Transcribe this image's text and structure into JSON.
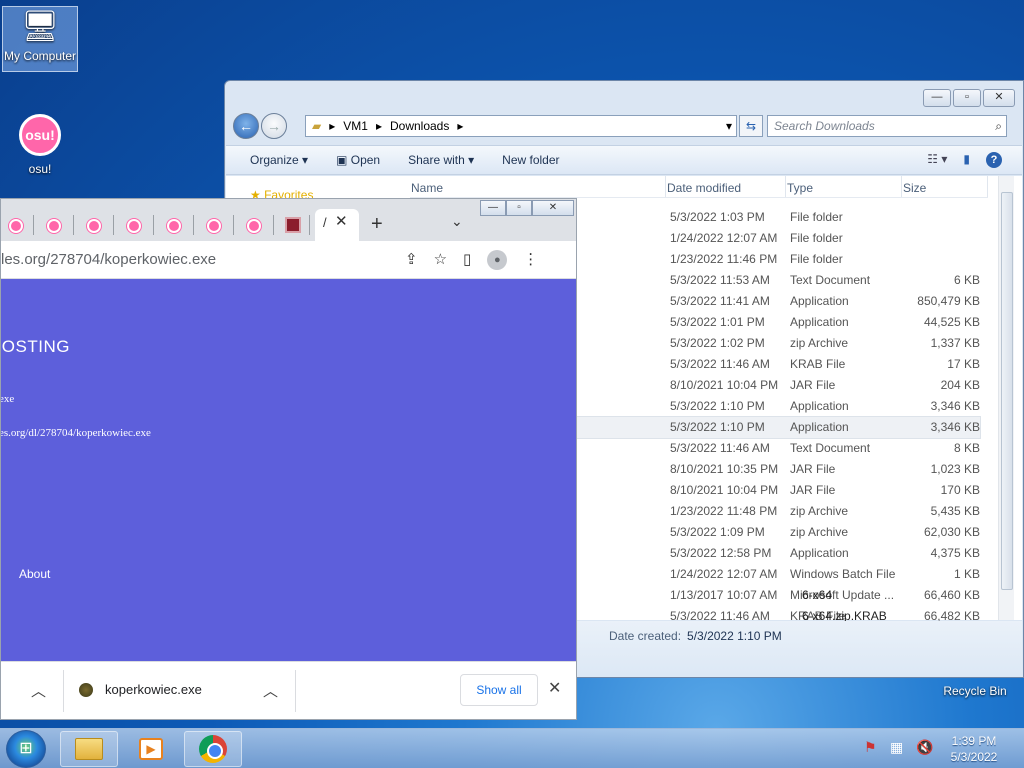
{
  "desktop": {
    "icons": [
      {
        "label": "My Computer",
        "glyph": "🖥"
      },
      {
        "label": "osu!",
        "badge": "osu!"
      },
      {
        "label": "Recycle Bin"
      }
    ]
  },
  "explorer": {
    "window_controls": [
      "—",
      "▫",
      "✕"
    ],
    "address": {
      "part1": "VM1",
      "part2": "Downloads"
    },
    "search_placeholder": "Search Downloads",
    "toolbar": {
      "organize": "Organize ▾",
      "open": "Open",
      "share_with": "Share with ▾",
      "new_folder": "New folder"
    },
    "nav_pane_favorites": "Favorites",
    "columns": {
      "name": "Name",
      "date": "Date modified",
      "type": "Type",
      "size": "Size"
    },
    "rows": [
      {
        "date": "5/3/2022 1:03 PM",
        "type": "File folder",
        "size": ""
      },
      {
        "date": "1/24/2022 12:07 AM",
        "type": "File folder",
        "size": ""
      },
      {
        "date": "1/23/2022 11:46 PM",
        "type": "File folder",
        "size": ""
      },
      {
        "date": "5/3/2022 11:53 AM",
        "type": "Text Document",
        "size": "6 KB"
      },
      {
        "date": "5/3/2022 11:41 AM",
        "type": "Application",
        "size": "850,479 KB"
      },
      {
        "date": "5/3/2022 1:01 PM",
        "type": "Application",
        "size": "44,525 KB"
      },
      {
        "date": "5/3/2022 1:02 PM",
        "type": "zip Archive",
        "size": "1,337 KB"
      },
      {
        "date": "5/3/2022 11:46 AM",
        "type": "KRAB File",
        "size": "17 KB"
      },
      {
        "date": "8/10/2021 10:04 PM",
        "type": "JAR File",
        "size": "204 KB"
      },
      {
        "date": "5/3/2022 1:10 PM",
        "type": "Application",
        "size": "3,346 KB"
      },
      {
        "date": "5/3/2022 1:10 PM",
        "type": "Application",
        "size": "3,346 KB",
        "selected": true
      },
      {
        "date": "5/3/2022 11:46 AM",
        "type": "Text Document",
        "size": "8 KB"
      },
      {
        "date": "8/10/2021 10:35 PM",
        "type": "JAR File",
        "size": "1,023 KB"
      },
      {
        "date": "8/10/2021 10:04 PM",
        "type": "JAR File",
        "size": "170 KB"
      },
      {
        "date": "1/23/2022 11:48 PM",
        "type": "zip Archive",
        "size": "5,435 KB"
      },
      {
        "date": "5/3/2022 1:09 PM",
        "type": "zip Archive",
        "size": "62,030 KB"
      },
      {
        "date": "5/3/2022 12:58 PM",
        "type": "Application",
        "size": "4,375 KB"
      },
      {
        "date": "1/24/2022 12:07 AM",
        "type": "Windows Batch File",
        "size": "1 KB"
      },
      {
        "date": "1/13/2017 10:07 AM",
        "type": "Microsoft Update ...",
        "size": "66,460 KB",
        "name_tail": "6-x64"
      },
      {
        "date": "5/3/2022 11:46 AM",
        "type": "KRAB File",
        "size": "66,482 KB",
        "name_tail": "6-x64.zip.KRAB"
      }
    ],
    "details": {
      "label": "Date created:",
      "value": "5/3/2022 1:10 PM"
    }
  },
  "chrome": {
    "active_tab_title": "/",
    "url_visible": "les.org/278704/koperkowiec.exe",
    "page": {
      "heading": "HOSTING",
      "line1": "exe",
      "line2": "es.org/dl/278704/koperkowiec.exe",
      "about": "About"
    },
    "download": {
      "filename": "koperkowiec.exe",
      "show_all": "Show all"
    }
  },
  "taskbar": {
    "clock_time": "1:39 PM",
    "clock_date": "5/3/2022"
  },
  "colors": {
    "chrome_page_bg": "#5d5fdb",
    "osu_pink": "#ff66aa",
    "link_blue": "#1a73e8"
  }
}
